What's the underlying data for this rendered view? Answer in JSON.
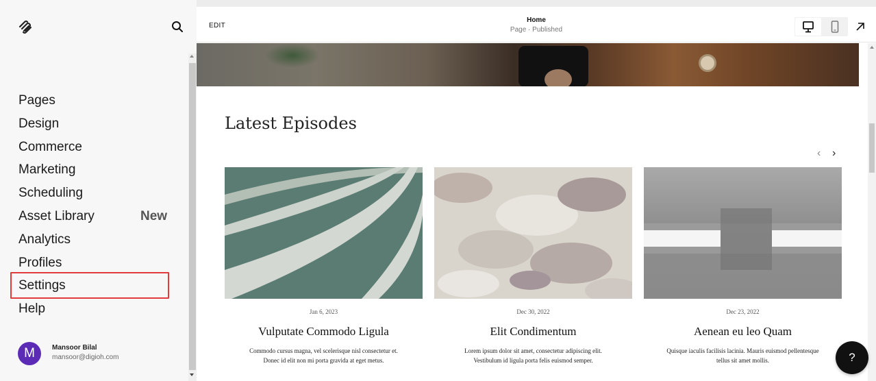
{
  "sidebar": {
    "logo_icon": "squarespace-logo-icon",
    "search_icon": "search-icon",
    "items": [
      {
        "label": "Pages"
      },
      {
        "label": "Design"
      },
      {
        "label": "Commerce"
      },
      {
        "label": "Marketing"
      },
      {
        "label": "Scheduling"
      },
      {
        "label": "Asset Library",
        "badge": "New"
      },
      {
        "label": "Analytics"
      },
      {
        "label": "Profiles"
      },
      {
        "label": "Settings",
        "highlighted": true
      },
      {
        "label": "Help"
      }
    ],
    "user": {
      "initial": "M",
      "name": "Mansoor Bilal",
      "email": "mansoor@digioh.com",
      "avatar_color": "#5b2bb5"
    }
  },
  "topbar": {
    "edit_label": "EDIT",
    "page_title": "Home",
    "page_status": "Page · Published",
    "device_icons": [
      "desktop-icon",
      "mobile-icon"
    ],
    "open_icon": "external-arrow-icon"
  },
  "content": {
    "section_title": "Latest Episodes",
    "carousel_prev_icon": "chevron-left-icon",
    "carousel_next_icon": "chevron-right-icon",
    "cards": [
      {
        "date": "Jan 6, 2023",
        "title": "Vulputate Commodo Ligula",
        "desc_line1": "Commodo cursus magna, vel scelerisque nisl consectetur et.",
        "desc_line2": "Donec id elit non mi porta gravida at eget metus."
      },
      {
        "date": "Dec 30, 2022",
        "title": "Elit Condimentum",
        "desc_line1": "Lorem ipsum dolor sit amet, consectetur adipiscing elit.",
        "desc_line2": "Vestibulum id ligula porta felis euismod semper."
      },
      {
        "date": "Dec 23, 2022",
        "title": "Aenean eu leo Quam",
        "desc_line1": "Quisque iaculis facilisis lacinia. Mauris euismod pellentesque",
        "desc_line2": "tellus sit amet mollis."
      }
    ]
  },
  "help_button": {
    "label": "?"
  },
  "colors": {
    "highlight_border": "#e03a3a",
    "sidebar_bg": "#f7f7f7",
    "help_bg": "#111111"
  }
}
